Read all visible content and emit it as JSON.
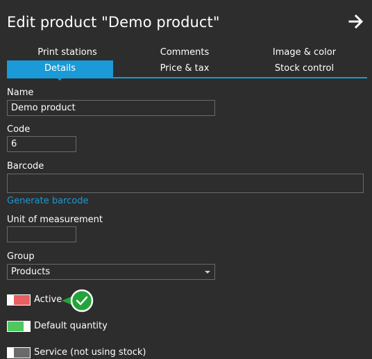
{
  "header": {
    "title": "Edit product \"Demo product\"",
    "close_icon": "arrow-right-icon"
  },
  "tabs": [
    {
      "label": "Print stations",
      "active": false
    },
    {
      "label": "Comments",
      "active": false
    },
    {
      "label": "Image & color",
      "active": false
    },
    {
      "label": "Details",
      "active": true
    },
    {
      "label": "Price & tax",
      "active": false
    },
    {
      "label": "Stock control",
      "active": false
    }
  ],
  "form": {
    "name": {
      "label": "Name",
      "value": "Demo product"
    },
    "code": {
      "label": "Code",
      "value": "6"
    },
    "barcode": {
      "label": "Barcode",
      "value": ""
    },
    "generate_barcode_label": "Generate barcode",
    "unit": {
      "label": "Unit of measurement",
      "value": ""
    },
    "group": {
      "label": "Group",
      "value": "Products"
    }
  },
  "toggles": [
    {
      "label": "Active",
      "on": false,
      "color": "#e8605f"
    },
    {
      "label": "Default quantity",
      "on": true,
      "color": "#4fc862"
    },
    {
      "label": "Service (not using stock)",
      "on": false,
      "color": "#6a6a6a"
    }
  ],
  "colors": {
    "background": "#2d2d2d",
    "accent": "#1a9ad6",
    "field_border": "#6a6a6a",
    "marker": "#24a33a"
  },
  "marker": {
    "icon": "checkmark-icon"
  }
}
